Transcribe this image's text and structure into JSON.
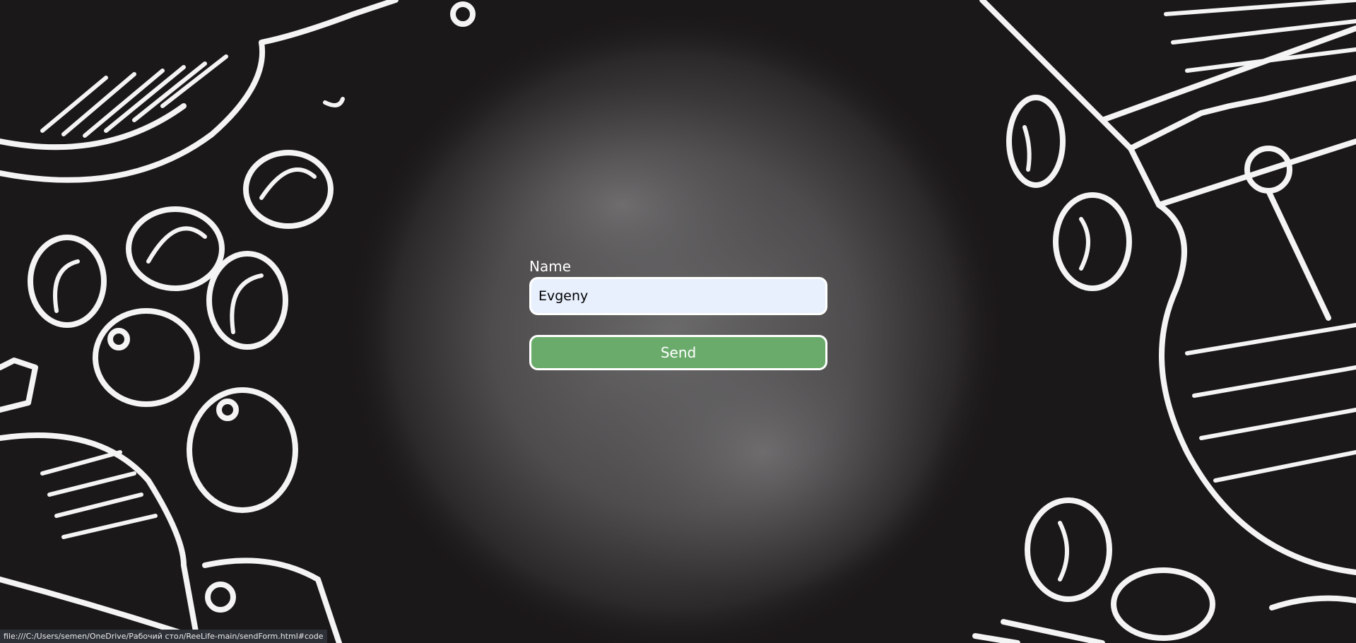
{
  "form": {
    "name_label": "Name",
    "name_value": "Evgeny",
    "send_label": "Send"
  },
  "status_bar": {
    "url": "file:///C:/Users/semen/OneDrive/Рабочий стол/ReeLife-main/sendForm.html#code"
  },
  "colors": {
    "background": "#1b1819",
    "input_background": "#e8f0fd",
    "send_button": "#6aab6b",
    "border": "#ffffff"
  }
}
